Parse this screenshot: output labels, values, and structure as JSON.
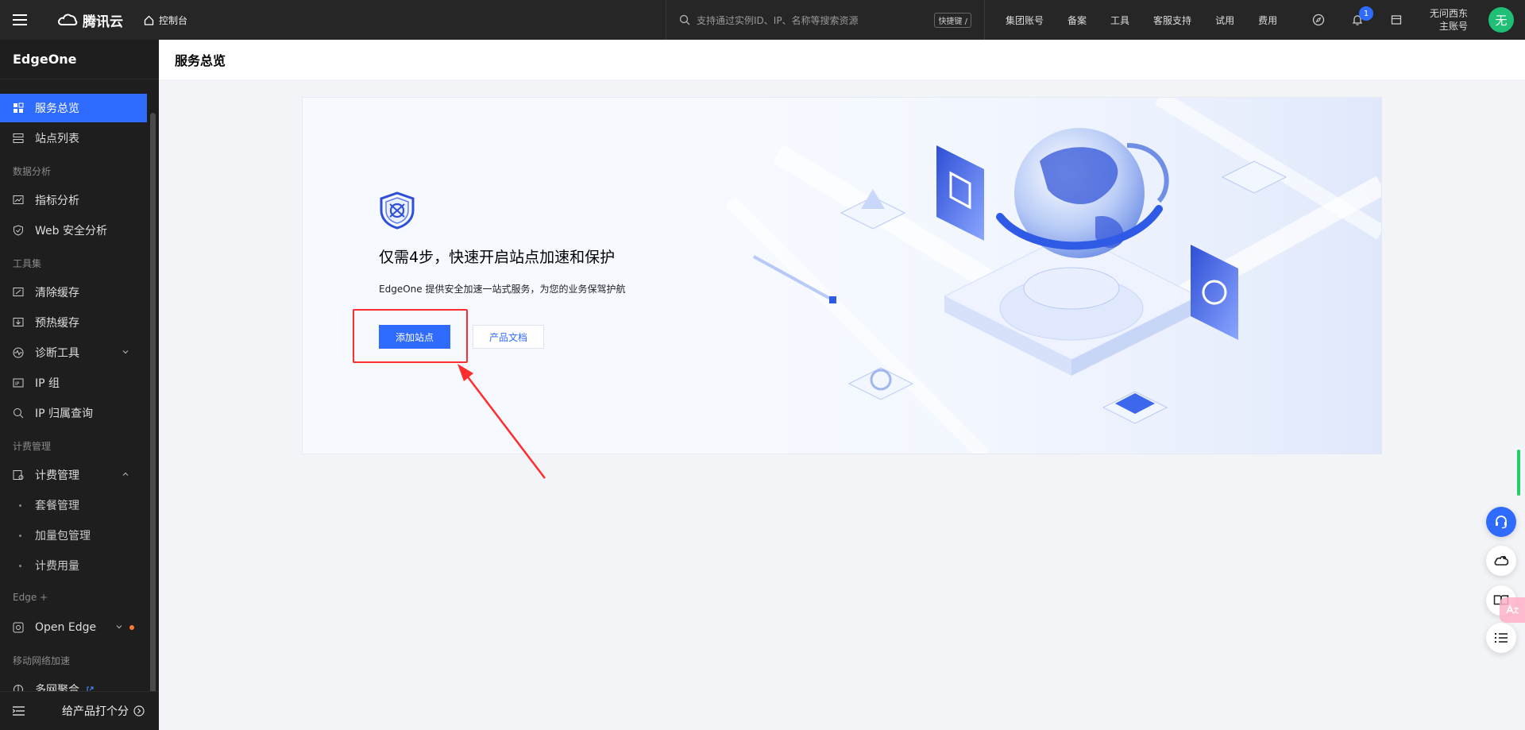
{
  "topbar": {
    "brand": "腾讯云",
    "console": "控制台",
    "search_placeholder": "支持通过实例ID、IP、名称等搜索资源",
    "shortcut": "快捷键 /",
    "nav": [
      "集团账号",
      "备案",
      "工具",
      "客服支持",
      "试用",
      "费用"
    ],
    "notification_count": "1",
    "user_name": "无问西东",
    "user_role": "主账号",
    "avatar_text": "无"
  },
  "sidebar": {
    "title": "EdgeOne",
    "items": {
      "overview": "服务总览",
      "sites": "站点列表",
      "sec_analysis": "数据分析",
      "metrics": "指标分析",
      "web_security": "Web 安全分析",
      "sec_tools": "工具集",
      "purge": "清除缓存",
      "prefetch": "预热缓存",
      "diagnose": "诊断工具",
      "ip_group": "IP 组",
      "ip_lookup": "IP 归属查询",
      "sec_billing": "计费管理",
      "billing": "计费管理",
      "plans": "套餐管理",
      "addons": "加量包管理",
      "usage": "计费用量",
      "sec_edge": "Edge +",
      "open_edge": "Open Edge",
      "sec_mobile": "移动网络加速",
      "multi_net": "多网聚合"
    },
    "rate": "给产品打个分"
  },
  "page": {
    "title": "服务总览"
  },
  "hero": {
    "title": "仅需4步，快速开启站点加速和保护",
    "desc": "EdgeOne 提供安全加速一站式服务，为您的业务保驾护航",
    "add_site": "添加站点",
    "docs": "产品文档"
  },
  "colors": {
    "accent": "#2f6bff",
    "topbar_bg": "#262626",
    "sidebar_bg": "#1e1e1e",
    "highlight": "#ff2d2d"
  }
}
